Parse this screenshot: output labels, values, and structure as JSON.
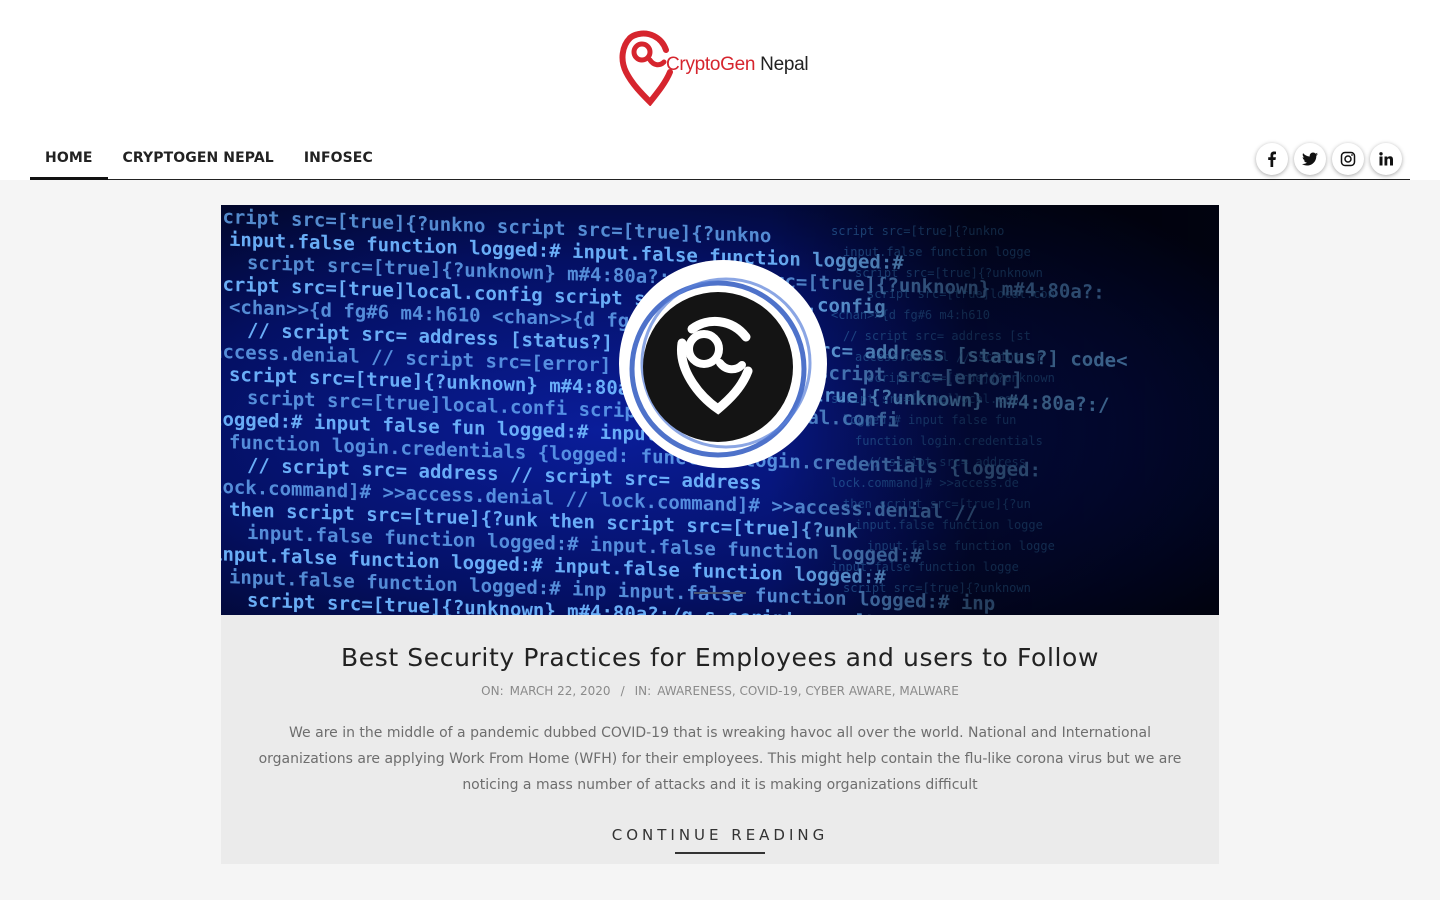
{
  "site": {
    "logo_part1": "CryptoGen",
    "logo_part2": " Nepal",
    "brand_red": "#d6252e"
  },
  "nav": {
    "items": [
      {
        "label": "Home",
        "active": true
      },
      {
        "label": "CryptoGen Nepal",
        "active": false
      },
      {
        "label": "Infosec",
        "active": false
      }
    ]
  },
  "social": {
    "items": [
      "facebook-icon",
      "twitter-icon",
      "instagram-icon",
      "linkedin-icon"
    ]
  },
  "post": {
    "title": "Best Security Practices for Employees and users to Follow",
    "on_label": "On:",
    "date": "March 22, 2020",
    "separator": "/",
    "in_label": "In:",
    "categories": [
      "Awareness",
      "COVID-19",
      "Cyber Aware",
      "Malware"
    ],
    "excerpt": "We are in the middle of a pandemic dubbed COVID-19 that is wreaking havoc all over the world. National and International organizations are applying Work From Home (WFH) for their employees. This might help contain the flu-like corona virus but we are noticing a mass number of attacks and it is making organizations difficult",
    "continue_label": "Continue Reading",
    "hero_code_lines": [
      "script src=[true]{?unkno",
      "input.false function logged:#",
      "script src=[true]{?unknown} m#4:80a?:",
      "script src=[true]local.config",
      "<chan>>{d fg#6 m4:h610",
      "// script src= address [status?] code<",
      "access.denial // script src=[error]",
      "script src=[true]{?unknown} m#4:80a?:/",
      "script src=[true]local.confi",
      "logged:# input false fun",
      "function login.credentials {logged:",
      "// script src= address",
      "lock.command]# >>access.denial //",
      "then script src=[true]{?unk",
      "input.false function logged:#",
      "input.false function logged:#",
      "input.false function logged:# inp",
      "script src=[true]{?unknown} m#4:80a?:/q.s"
    ]
  }
}
